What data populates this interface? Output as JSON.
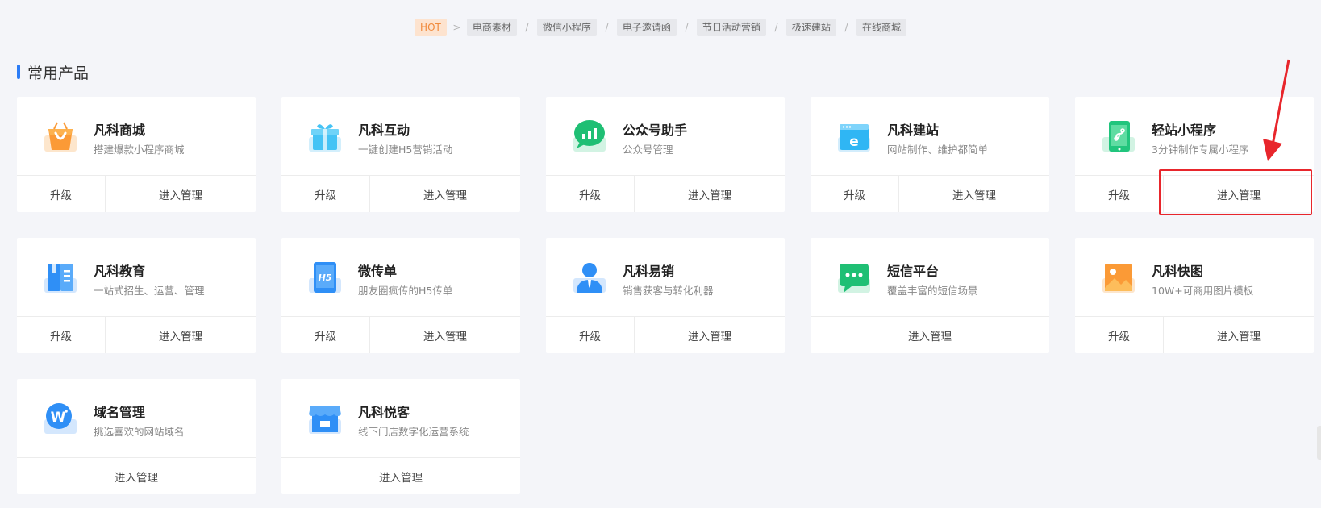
{
  "tags": {
    "hot": "HOT",
    "items": [
      "电商素材",
      "微信小程序",
      "电子邀请函",
      "节日活动营销",
      "极速建站",
      "在线商城"
    ],
    "first_sep": ">",
    "sep": "/"
  },
  "section": {
    "title": "常用产品"
  },
  "labels": {
    "upgrade": "升级",
    "manage": "进入管理"
  },
  "cards": [
    {
      "name": "凡科商城",
      "desc": "搭建爆款小程序商城",
      "icon": "shopping-bag-icon"
    },
    {
      "name": "凡科互动",
      "desc": "一键创建H5营销活动",
      "icon": "gift-icon"
    },
    {
      "name": "公众号助手",
      "desc": "公众号管理",
      "icon": "chat-chart-icon"
    },
    {
      "name": "凡科建站",
      "desc": "网站制作、维护都简单",
      "icon": "browser-e-icon"
    },
    {
      "name": "轻站小程序",
      "desc": "3分钟制作专属小程序",
      "icon": "phone-miniprogram-icon"
    },
    {
      "name": "凡科教育",
      "desc": "一站式招生、运营、管理",
      "icon": "book-icon"
    },
    {
      "name": "微传单",
      "desc": "朋友圈疯传的H5传单",
      "icon": "h5-tablet-icon"
    },
    {
      "name": "凡科易销",
      "desc": "销售获客与转化利器",
      "icon": "salesperson-icon"
    },
    {
      "name": "短信平台",
      "desc": "覆盖丰富的短信场景",
      "icon": "sms-bubble-icon"
    },
    {
      "name": "凡科快图",
      "desc": "10W+可商用图片模板",
      "icon": "picture-icon"
    },
    {
      "name": "域名管理",
      "desc": "挑选喜欢的网站域名",
      "icon": "domain-w-icon"
    },
    {
      "name": "凡科悦客",
      "desc": "线下门店数字化运营系统",
      "icon": "storefront-icon"
    }
  ],
  "colors": {
    "accent": "#2b7cf6",
    "highlight": "#e8262c",
    "hot_bg": "#fde3cf",
    "hot_text": "#f08a3c"
  }
}
